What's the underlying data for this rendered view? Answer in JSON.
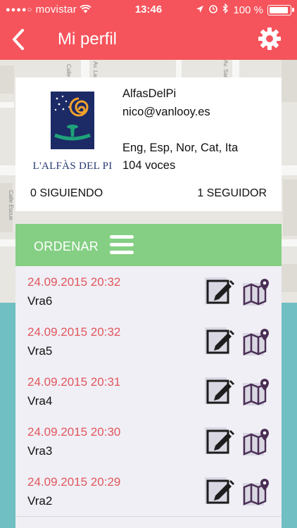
{
  "status_bar": {
    "carrier": "movistar",
    "time": "13:46",
    "battery": "100 %"
  },
  "header": {
    "title": "Mi perfil",
    "background": "#f5545c"
  },
  "profile": {
    "logo_text": "L'ALFÀS DEL PI",
    "username": "AlfasDelPi",
    "email": "nico@vanlooy.es",
    "languages": "Eng, Esp, Nor, Cat, Ita",
    "voices": "104 voces",
    "following": "0 SIGUIENDO",
    "followers": "1 SEGUIDOR"
  },
  "sort_bar": {
    "label": "ORDENAR",
    "background": "#84cf83"
  },
  "routes": [
    {
      "date": "24.09.2015 20:32",
      "name": "Vra6"
    },
    {
      "date": "24.09.2015 20:32",
      "name": "Vra5"
    },
    {
      "date": "24.09.2015 20:31",
      "name": "Vra4"
    },
    {
      "date": "24.09.2015 20:30",
      "name": "Vra3"
    },
    {
      "date": "24.09.2015 20:29",
      "name": "Vra2"
    }
  ],
  "map": {
    "labels": [
      "Calle Gutie",
      "Av. Las Na",
      "Calle Escue",
      "Av. Sam"
    ]
  }
}
